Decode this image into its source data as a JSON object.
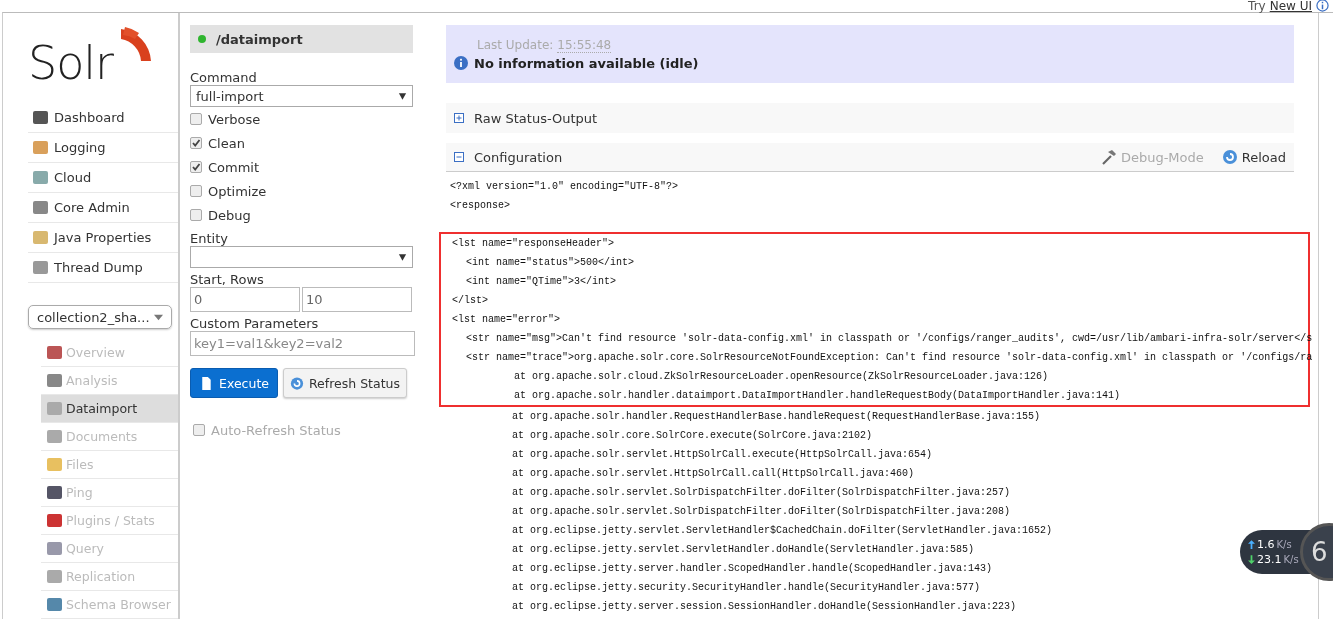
{
  "top_link": {
    "prefix": "Try",
    "link": "New UI"
  },
  "logo": {
    "text": "Solr"
  },
  "main_nav": [
    {
      "label": "Dashboard"
    },
    {
      "label": "Logging"
    },
    {
      "label": "Cloud"
    },
    {
      "label": "Core Admin"
    },
    {
      "label": "Java Properties"
    },
    {
      "label": "Thread Dump"
    }
  ],
  "core_selector": {
    "value": "collection2_sha..."
  },
  "core_nav": [
    {
      "label": "Overview",
      "selected": false
    },
    {
      "label": "Analysis",
      "selected": false
    },
    {
      "label": "Dataimport",
      "selected": true
    },
    {
      "label": "Documents",
      "selected": false
    },
    {
      "label": "Files",
      "selected": false
    },
    {
      "label": "Ping",
      "selected": false
    },
    {
      "label": "Plugins / Stats",
      "selected": false
    },
    {
      "label": "Query",
      "selected": false
    },
    {
      "label": "Replication",
      "selected": false
    },
    {
      "label": "Schema Browser",
      "selected": false
    }
  ],
  "handler": {
    "name": "/dataimport",
    "color": "#2fb52f"
  },
  "form": {
    "command_label": "Command",
    "command": "full-import",
    "options": [
      {
        "label": "Verbose",
        "checked": false
      },
      {
        "label": "Clean",
        "checked": true
      },
      {
        "label": "Commit",
        "checked": true
      },
      {
        "label": "Optimize",
        "checked": false
      },
      {
        "label": "Debug",
        "checked": false
      }
    ],
    "entity_label": "Entity",
    "start_rows_label": "Start, Rows",
    "start": "0",
    "rows": "10",
    "custom_label": "Custom Parameters",
    "custom_placeholder": "key1=val1&key2=val2",
    "execute": "Execute",
    "refresh": "Refresh Status",
    "auto_refresh": {
      "label": "Auto-Refresh Status",
      "checked": false
    }
  },
  "status": {
    "last_update_label": "Last Update:",
    "last_update": "15:55:48",
    "message": "No information available (idle)"
  },
  "raw_status": {
    "title": "Raw Status-Output",
    "expanded": false
  },
  "configuration": {
    "title": "Configuration",
    "expanded": true,
    "debug_mode": "Debug-Mode",
    "reload": "Reload",
    "lines": [
      {
        "text": "<?xml version=\"1.0\" encoding=\"UTF-8\"?>",
        "highlighted": false
      },
      {
        "text": "<response>",
        "highlighted": false
      },
      {
        "text": "<lst name=\"responseHeader\">",
        "highlighted": true,
        "children": [
          {
            "text": "<int name=\"status\">500</int>",
            "highlighted": true
          },
          {
            "text": "<int name=\"QTime\">3</int>",
            "highlighted": true
          }
        ]
      },
      {
        "text": "</lst>",
        "highlighted": true
      },
      {
        "text": "<lst name=\"error\">",
        "highlighted": true,
        "children": [
          {
            "text": "<str name=\"msg\">Can't find resource 'solr-data-config.xml' in classpath or '/configs/ranger_audits', cwd=/usr/lib/ambari-infra-solr/server</s",
            "highlighted": true
          },
          {
            "text": "<str name=\"trace\">org.apache.solr.core.SolrResourceNotFoundException: Can't find resource 'solr-data-config.xml' in classpath or '/configs/ra",
            "highlighted": true,
            "children": [
              {
                "text": "at org.apache.solr.cloud.ZkSolrResourceLoader.openResource(ZkSolrResourceLoader.java:126)",
                "highlighted": true
              },
              {
                "text": "at org.apache.solr.handler.dataimport.DataImportHandler.handleRequestBody(DataImportHandler.java:141)",
                "highlighted": true
              },
              {
                "text": "at org.apache.solr.handler.RequestHandlerBase.handleRequest(RequestHandlerBase.java:155)",
                "highlighted": false
              },
              {
                "text": "at org.apache.solr.core.SolrCore.execute(SolrCore.java:2102)",
                "highlighted": false
              },
              {
                "text": "at org.apache.solr.servlet.HttpSolrCall.execute(HttpSolrCall.java:654)",
                "highlighted": false
              },
              {
                "text": "at org.apache.solr.servlet.HttpSolrCall.call(HttpSolrCall.java:460)",
                "highlighted": false
              },
              {
                "text": "at org.apache.solr.servlet.SolrDispatchFilter.doFilter(SolrDispatchFilter.java:257)",
                "highlighted": false
              },
              {
                "text": "at org.apache.solr.servlet.SolrDispatchFilter.doFilter(SolrDispatchFilter.java:208)",
                "highlighted": false
              },
              {
                "text": "at org.eclipse.jetty.servlet.ServletHandler$CachedChain.doFilter(ServletHandler.java:1652)",
                "highlighted": false
              },
              {
                "text": "at org.eclipse.jetty.servlet.ServletHandler.doHandle(ServletHandler.java:585)",
                "highlighted": false
              },
              {
                "text": "at org.eclipse.jetty.server.handler.ScopedHandler.handle(ScopedHandler.java:143)",
                "highlighted": false
              },
              {
                "text": "at org.eclipse.jetty.security.SecurityHandler.handle(SecurityHandler.java:577)",
                "highlighted": false
              },
              {
                "text": "at org.eclipse.jetty.server.session.SessionHandler.doHandle(SessionHandler.java:223)",
                "highlighted": false
              }
            ]
          }
        ]
      }
    ]
  },
  "speed_widget": {
    "up": "1.6",
    "up_unit": "K/s",
    "down": "23.1",
    "down_unit": "K/s",
    "gauge": "6"
  }
}
